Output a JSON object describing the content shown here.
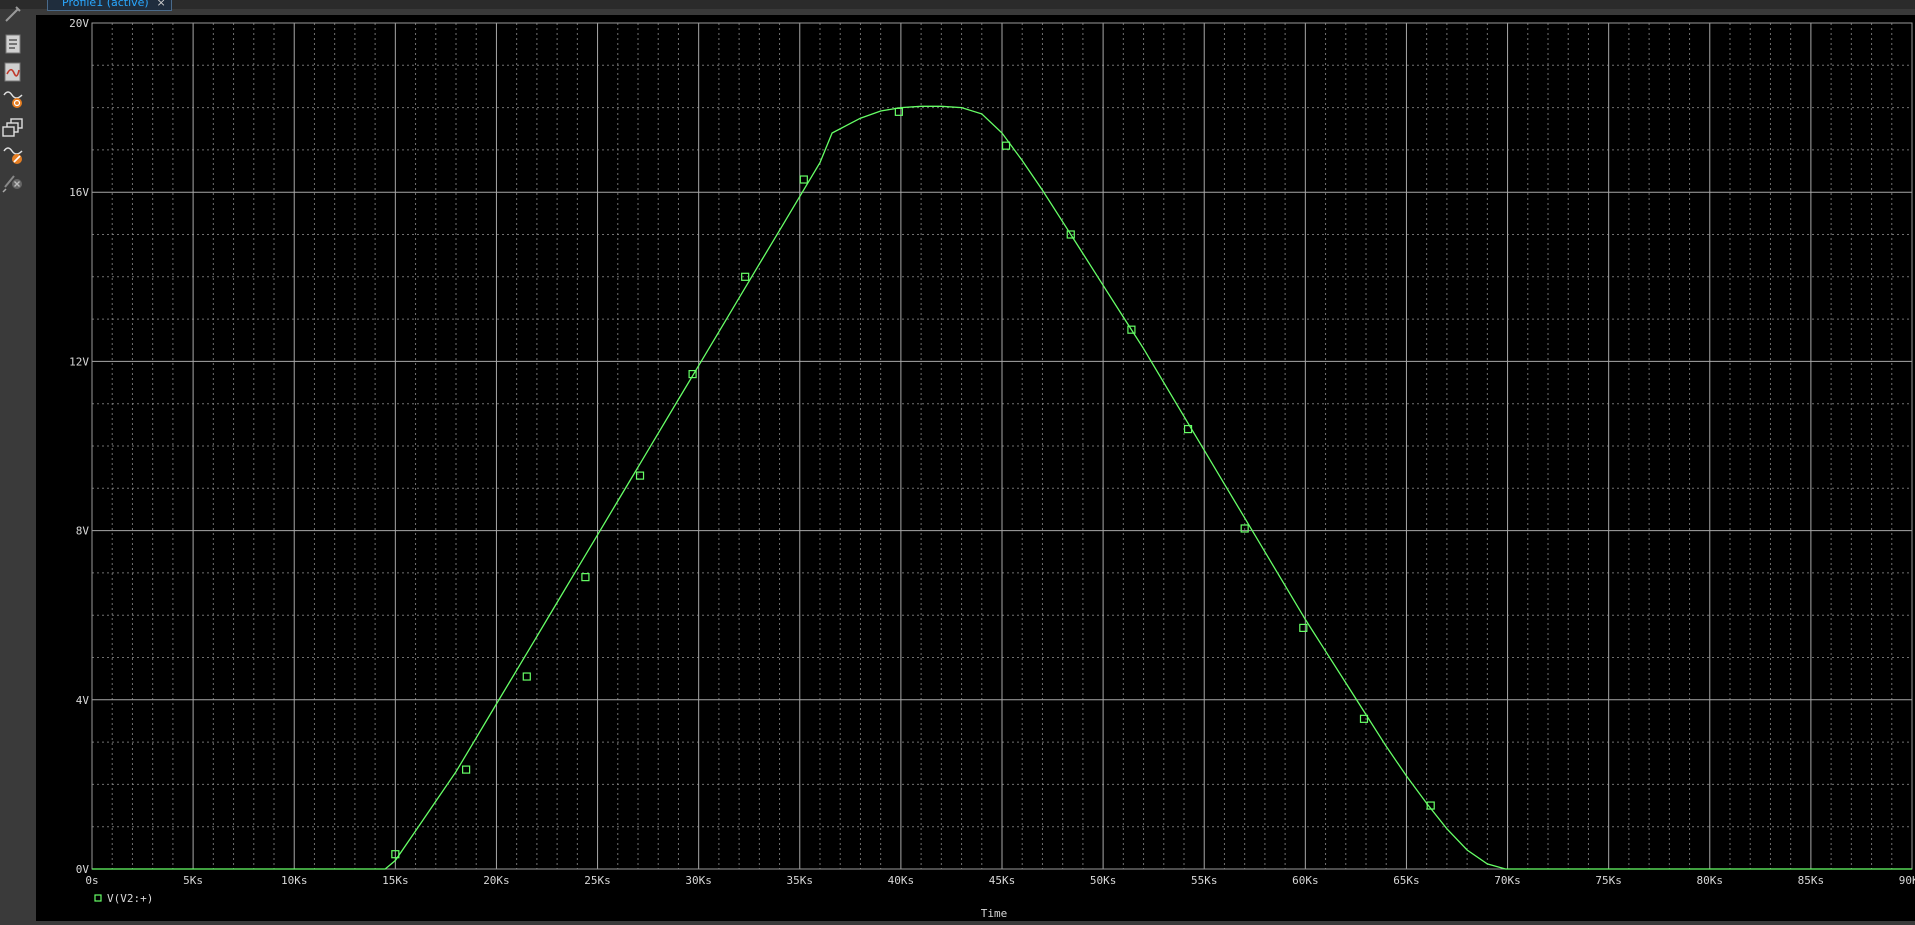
{
  "window": {
    "tab_label": "Profile1 (active)",
    "tab_close": "×"
  },
  "toolbar": {
    "icons": [
      "probe-cursor-icon",
      "netlist-icon",
      "plot-settings-icon",
      "zoom-icon",
      "window-cascade-icon",
      "measurement-icon",
      "clear-probe-icon"
    ]
  },
  "colors": {
    "background": "#000000",
    "grid": "#8c8c8c",
    "trace": "#66ff66",
    "text": "#d8d8d8",
    "tab_text": "#2aa8ff"
  },
  "chart_data": {
    "type": "line",
    "xlabel": "Time",
    "ylabel": "",
    "xlim": [
      0,
      90
    ],
    "ylim": [
      0,
      20
    ],
    "x_unit": "Ks",
    "y_unit": "V",
    "xticks": [
      "0s",
      "5Ks",
      "10Ks",
      "15Ks",
      "20Ks",
      "25Ks",
      "30Ks",
      "35Ks",
      "40Ks",
      "45Ks",
      "50Ks",
      "55Ks",
      "60Ks",
      "65Ks",
      "70Ks",
      "75Ks",
      "80Ks",
      "85Ks",
      "90Ks"
    ],
    "yticks": [
      "0V",
      "4V",
      "8V",
      "12V",
      "16V",
      "20V"
    ],
    "grid": true,
    "legend": {
      "position": "bottom-left",
      "entries": [
        "V(V2:+)"
      ]
    },
    "series": [
      {
        "name": "V(V2:+)",
        "color": "#66ff66",
        "marker": "square-hollow",
        "x": [
          0,
          14.5,
          15.0,
          16.0,
          17.0,
          18.0,
          19.0,
          20.0,
          21.0,
          22.0,
          23.0,
          24.0,
          25.0,
          26.0,
          27.0,
          28.0,
          29.0,
          30.0,
          31.0,
          32.0,
          33.0,
          34.0,
          35.0,
          36.0,
          36.6,
          38.0,
          39.0,
          40.0,
          41.0,
          42.0,
          43.0,
          44.0,
          45.0,
          46.0,
          47.0,
          48.0,
          49.0,
          50.0,
          51.0,
          52.0,
          53.0,
          54.0,
          55.0,
          56.0,
          57.0,
          58.0,
          59.0,
          60.0,
          61.0,
          62.0,
          63.0,
          64.0,
          65.0,
          66.0,
          67.0,
          68.0,
          69.0,
          69.9,
          90
        ],
        "y": [
          0,
          0,
          0.2,
          0.9,
          1.6,
          2.3,
          3.1,
          3.9,
          4.7,
          5.5,
          6.3,
          7.1,
          7.9,
          8.7,
          9.5,
          10.3,
          11.1,
          11.9,
          12.7,
          13.5,
          14.3,
          15.1,
          15.9,
          16.7,
          17.4,
          17.75,
          17.92,
          18.0,
          18.03,
          18.03,
          18.0,
          17.85,
          17.4,
          16.75,
          16.05,
          15.3,
          14.55,
          13.8,
          13.05,
          12.3,
          11.5,
          10.7,
          9.9,
          9.1,
          8.3,
          7.5,
          6.7,
          5.9,
          5.15,
          4.4,
          3.65,
          2.9,
          2.2,
          1.55,
          0.95,
          0.45,
          0.12,
          0,
          0
        ],
        "markers_x": [
          15.0,
          18.5,
          21.5,
          24.4,
          27.1,
          29.7,
          32.3,
          35.2,
          39.9,
          45.2,
          48.4,
          51.4,
          54.2,
          57.0,
          59.9,
          62.9,
          66.2
        ],
        "markers_y": [
          0.35,
          2.35,
          4.55,
          6.9,
          9.3,
          11.7,
          14.0,
          16.3,
          17.9,
          17.1,
          15.0,
          12.75,
          10.4,
          8.05,
          5.7,
          3.55,
          1.5
        ]
      }
    ]
  }
}
